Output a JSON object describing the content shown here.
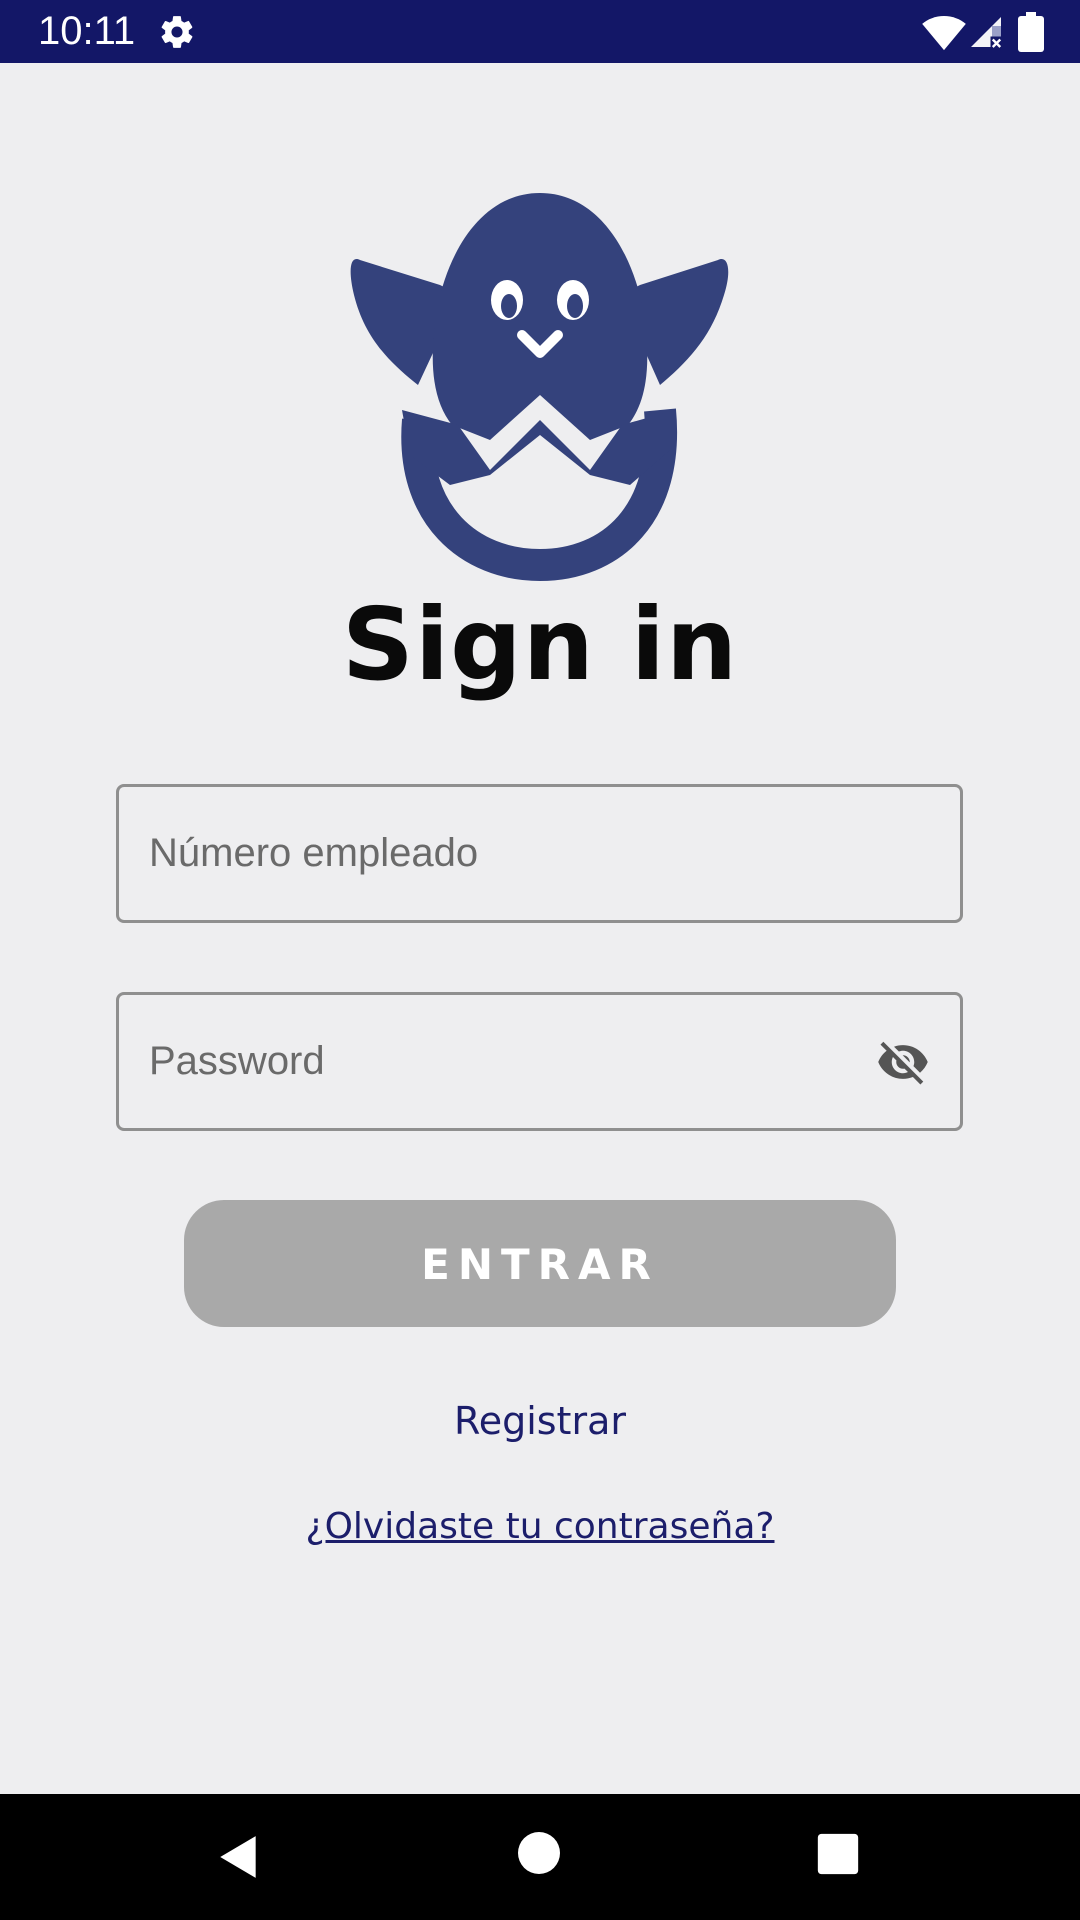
{
  "status_bar": {
    "time": "10:11",
    "icons": [
      "gear-icon",
      "wifi-icon",
      "signal-icon",
      "battery-icon"
    ],
    "background": "#131767"
  },
  "logo": {
    "icon": "chick-in-egg-logo",
    "color": "#34427c"
  },
  "title": "Sign in",
  "form": {
    "employee_number": {
      "placeholder": "Número empleado",
      "value": ""
    },
    "password": {
      "placeholder": "Password",
      "value": "",
      "toggle_icon": "visibility-off-icon"
    },
    "submit_label": "ENTRAR",
    "submit_color": "#a9a9a9"
  },
  "links": {
    "register": "Registrar",
    "forgot_password": "¿Olvidaste tu contraseña?",
    "color": "#1c1e6b"
  },
  "nav_bar": {
    "icons": [
      "back-icon",
      "home-icon",
      "recents-icon"
    ]
  }
}
